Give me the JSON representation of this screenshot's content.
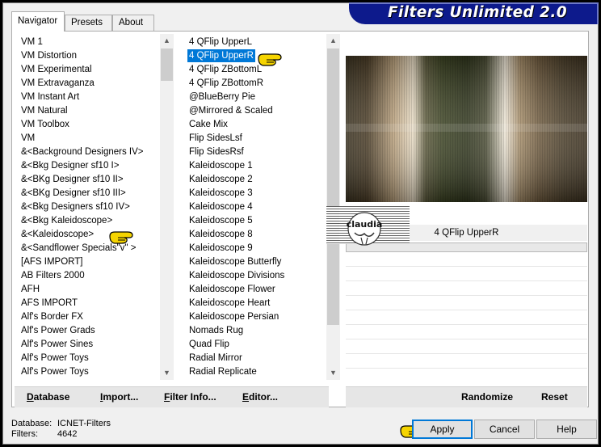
{
  "banner": {
    "title": "Filters Unlimited 2.0"
  },
  "tabs": [
    {
      "label": "Navigator",
      "active": true
    },
    {
      "label": "Presets",
      "active": false
    },
    {
      "label": "About",
      "active": false
    }
  ],
  "categories": {
    "items": [
      "VM 1",
      "VM Distortion",
      "VM Experimental",
      "VM Extravaganza",
      "VM Instant Art",
      "VM Natural",
      "VM Toolbox",
      "VM",
      "&<Background Designers IV>",
      "&<Bkg Designer sf10 I>",
      "&<BKg Designer sf10 II>",
      "&<BKg Designer sf10 III>",
      "&<Bkg Designers sf10 IV>",
      "&<Bkg Kaleidoscope>",
      "&<Kaleidoscope>",
      "&<Sandflower Specials\"v\" >",
      "[AFS IMPORT]",
      "AB Filters 2000",
      "AFH",
      "AFS IMPORT",
      "Alf's Border FX",
      "Alf's Power Grads",
      "Alf's Power Sines",
      "Alf's Power Toys",
      "Alf's Power Toys"
    ],
    "highlighted": "&<Bkg Kaleidoscope>"
  },
  "filters": {
    "items": [
      "4 QFlip UpperL",
      "4 QFlip UpperR",
      "4 QFlip ZBottomL",
      "4 QFlip ZBottomR",
      "@BlueBerry Pie",
      "@Mirrored & Scaled",
      "Cake Mix",
      "Flip SidesLsf",
      "Flip SidesRsf",
      "Kaleidoscope 1",
      "Kaleidoscope 2",
      "Kaleidoscope 3",
      "Kaleidoscope 4",
      "Kaleidoscope 5",
      "Kaleidoscope 8",
      "Kaleidoscope 9",
      "Kaleidoscope Butterfly",
      "Kaleidoscope Divisions",
      "Kaleidoscope Flower",
      "Kaleidoscope Heart",
      "Kaleidoscope Persian",
      "Nomads Rug",
      "Quad Flip",
      "Radial Mirror",
      "Radial Replicate",
      "Radial Replicate"
    ],
    "selected": "4 QFlip UpperR"
  },
  "preview": {
    "filter_name": "4 QFlip UpperR"
  },
  "watermark": {
    "text": "claudia"
  },
  "left_toolbar": [
    {
      "label": "Database",
      "ul": "D"
    },
    {
      "label": "Import...",
      "ul": "I"
    },
    {
      "label": "Filter Info...",
      "ul": "F"
    },
    {
      "label": "Editor...",
      "ul": "E"
    }
  ],
  "right_toolbar": [
    {
      "label": "Randomize"
    },
    {
      "label": "Reset"
    }
  ],
  "status": {
    "database_label": "Database:",
    "database_value": "ICNET-Filters",
    "filters_label": "Filters:",
    "filters_value": "4642"
  },
  "buttons": {
    "apply": "Apply",
    "cancel": "Cancel",
    "help": "Help"
  },
  "colors": {
    "banner": "#0d1a8c",
    "selection": "#0078d7",
    "pointer": "#f5d400"
  }
}
